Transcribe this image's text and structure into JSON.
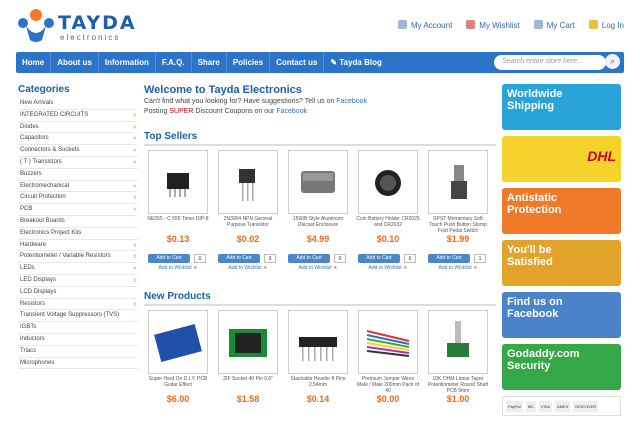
{
  "brand": {
    "name": "TAYDA",
    "sub": "electronics"
  },
  "account": [
    "My Account",
    "My Wishlist",
    "My Cart",
    "Log In"
  ],
  "nav": [
    "Home",
    "About us",
    "Information",
    "F.A.Q.",
    "Share",
    "Policies",
    "Contact us",
    "Tayda Blog"
  ],
  "search": {
    "placeholder": "Search entire store here..."
  },
  "categories_title": "Categories",
  "categories": [
    {
      "label": "New Arrivals",
      "arrow": false
    },
    {
      "label": "INTEGRATED CIRCUITS",
      "arrow": true
    },
    {
      "label": "Diodes",
      "arrow": true
    },
    {
      "label": "Capacitors",
      "arrow": true
    },
    {
      "label": "Connectors & Sockets",
      "arrow": true
    },
    {
      "label": "( T ) Transistors",
      "arrow": true
    },
    {
      "label": "Buzzers",
      "arrow": false
    },
    {
      "label": "Electromechanical",
      "arrow": true
    },
    {
      "label": "Circuit Protection",
      "arrow": true
    },
    {
      "label": "PCB",
      "arrow": true
    },
    {
      "label": "Breakout Boards",
      "arrow": false
    },
    {
      "label": "Electronics Project Kits",
      "arrow": false
    },
    {
      "label": "Hardware",
      "arrow": true
    },
    {
      "label": "Potentiometer / Variable Resistors",
      "arrow": true
    },
    {
      "label": "LEDs",
      "arrow": true
    },
    {
      "label": "LED Displays",
      "arrow": true
    },
    {
      "label": "LCD Displays",
      "arrow": false
    },
    {
      "label": "Resistors",
      "arrow": true
    },
    {
      "label": "Transient Voltage Suppressors (TVS)",
      "arrow": false
    },
    {
      "label": "IGBTs",
      "arrow": false
    },
    {
      "label": "Inductors",
      "arrow": false
    },
    {
      "label": "Triacs",
      "arrow": false
    },
    {
      "label": "Microphones",
      "arrow": false
    }
  ],
  "welcome": {
    "title": "Welcome to Tayda Electronics",
    "line1": "Can't find what you looking for? Have suggestions? Tell us on",
    "line1_link": "Facebook",
    "line2_pre": "Posting",
    "line2_super": "SUPER",
    "line2_mid": "Discount Coupons on our",
    "line2_link": "Facebook"
  },
  "top_sellers": {
    "title": "Top Sellers",
    "items": [
      {
        "name": "NE555 - C 555 Timer DIP-8",
        "price": "$0.13",
        "qty": "0"
      },
      {
        "name": "2N3904 NPN General Purpose Transistor",
        "price": "$0.02",
        "qty": "0"
      },
      {
        "name": "1590B Style Aluminum Diecast Enclosure",
        "price": "$4.99",
        "qty": "0"
      },
      {
        "name": "Coin Battery Holder CR2025 and CR2032",
        "price": "$0.10",
        "qty": "0"
      },
      {
        "name": "SPST Momentary Soft Touch Push Button Stomp Foot Pedal Switch",
        "price": "$1.99",
        "qty": "1"
      }
    ],
    "cart_label": "Add to Cart",
    "wish_label": "Add to Wishlist"
  },
  "new_products": {
    "title": "New Products",
    "items": [
      {
        "name": "Super Hard On D.I.Y. PCB Guitar Effect",
        "price": "$6.00"
      },
      {
        "name": "ZIF Socket 40 Pin 0.6\"",
        "price": "$1.58"
      },
      {
        "name": "Stackable Header 8 Pins 2.54mm",
        "price": "$0.14"
      },
      {
        "name": "Premium Jumper Wires Male / Male 200mm Pack of 40",
        "price": "$0.00"
      },
      {
        "name": "10K OHM Linear Taper Potentiometer Round Shaft PCB 9mm",
        "price": "$1.00"
      }
    ]
  },
  "banners": [
    {
      "l1": "Worldwide",
      "l2": "Shipping",
      "color": "#2aa3d8"
    },
    {
      "l1": "DHL",
      "l2": "",
      "color": "#f6d32a"
    },
    {
      "l1": "Antistatic",
      "l2": "Protection",
      "color": "#f07a2a"
    },
    {
      "l1": "You'll be",
      "l2": "Satisfied",
      "color": "#e2a32a"
    },
    {
      "l1": "Find us on",
      "l2": "Facebook",
      "color": "#4a83c8"
    },
    {
      "l1": "Godaddy.com",
      "l2": "Security",
      "color": "#35a848"
    }
  ],
  "payments": [
    "PayPal",
    "MC",
    "VISA",
    "AMEX",
    "DISCOVER"
  ]
}
